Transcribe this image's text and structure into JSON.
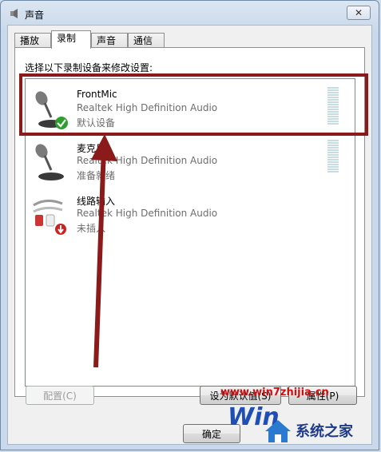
{
  "window": {
    "title": "声音",
    "close_glyph": "✕"
  },
  "tabs": [
    {
      "label": "播放"
    },
    {
      "label": "录制"
    },
    {
      "label": "声音"
    },
    {
      "label": "通信"
    }
  ],
  "active_tab": "录制",
  "prompt": "选择以下录制设备来修改设置:",
  "devices": [
    {
      "name": "FrontMic",
      "driver": "Realtek High Definition Audio",
      "status": "默认设备",
      "icon": "microphone-icon",
      "badge": "default-check-icon"
    },
    {
      "name": "麦克风",
      "driver": "Realtek High Definition Audio",
      "status": "准备就绪",
      "icon": "microphone-icon"
    },
    {
      "name": "线路输入",
      "driver": "Realtek High Definition Audio",
      "status": "未插入",
      "icon": "line-in-cable-icon",
      "badge": "unplugged-icon"
    }
  ],
  "buttons": {
    "configure": "配置(C)",
    "set_default": "设为默认值(S)",
    "properties": "属性(P)",
    "ok": "确定"
  },
  "watermark": {
    "url": "www.win7zhijia.cn",
    "logo_text": "系统之家",
    "win_text": "Win"
  },
  "colors": {
    "highlight_border": "#8b1a1a",
    "arrow": "#8b1a1a",
    "check_badge": "#2e9e2e",
    "unplugged_badge": "#cc2222"
  }
}
